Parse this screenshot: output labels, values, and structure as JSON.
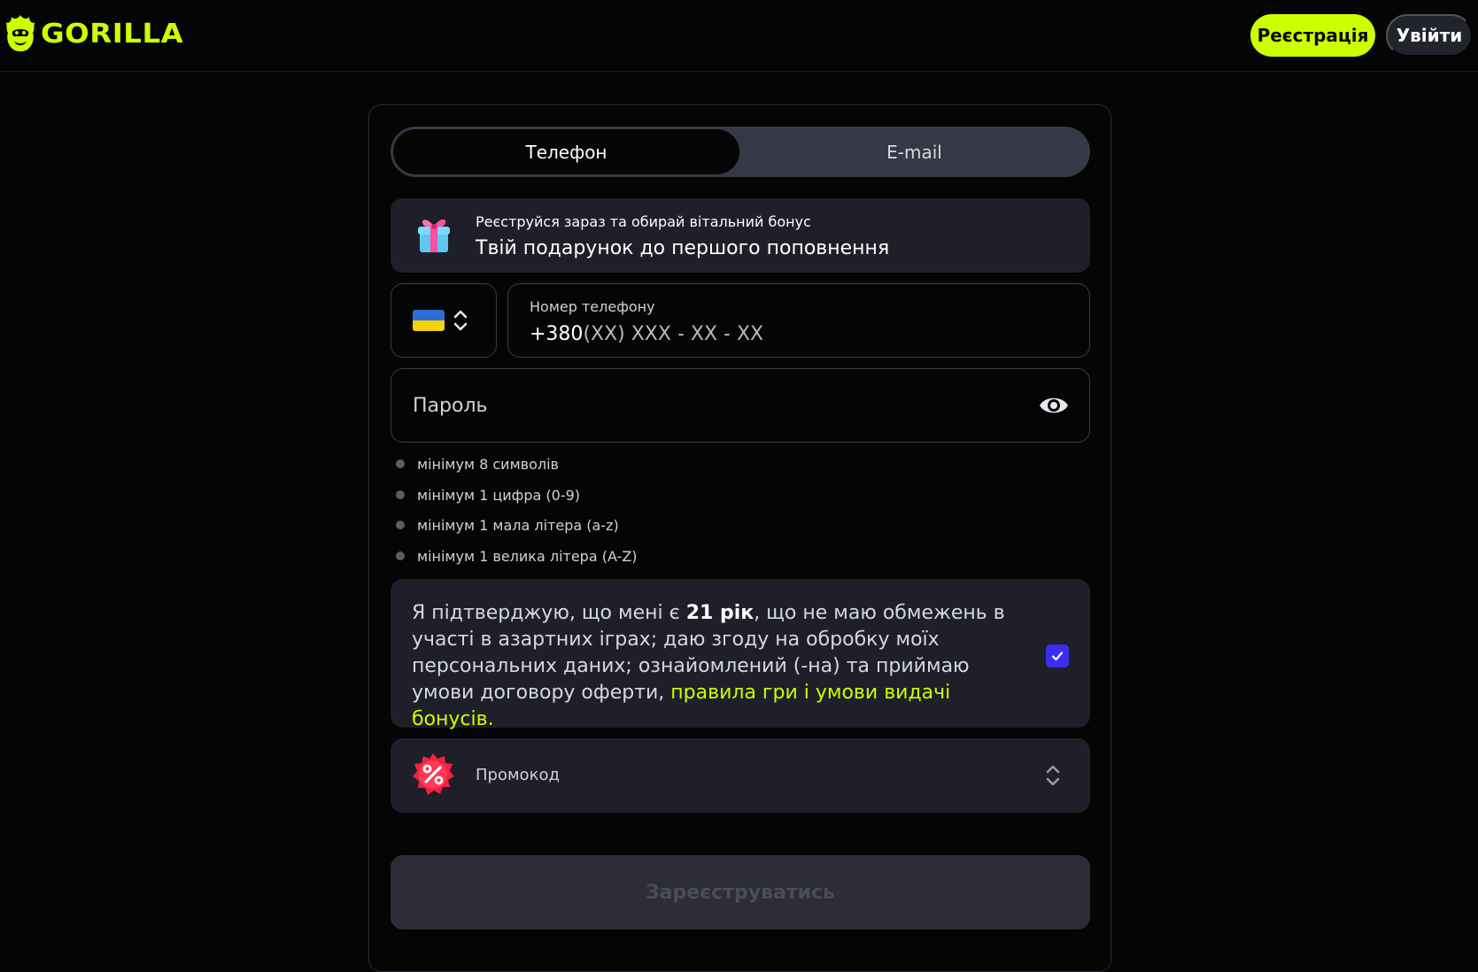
{
  "header": {
    "brand": "GORILLA",
    "register_label": "Реєстрація",
    "login_label": "Увійти"
  },
  "tabs": [
    {
      "label": "Телефон",
      "active": true
    },
    {
      "label": "E-mail",
      "active": false
    }
  ],
  "bonus": {
    "subtitle": "Реєструйся зараз та обирай вітальний бонус",
    "title": "Твій подарунок до першого поповнення"
  },
  "phone": {
    "country": "UA",
    "label": "Номер телефону",
    "prefix": "+380",
    "mask": "(XX) XXX - XX - XX"
  },
  "password": {
    "placeholder": "Пароль"
  },
  "password_rules": [
    "мінімум 8 символів",
    "мінімум 1 цифра (0-9)",
    "мінімум 1 мала літера (a-z)",
    "мінімум 1 велика літера (A-Z)"
  ],
  "consent": {
    "text_before": "Я підтверджую, що мені є ",
    "age": "21 рік",
    "text_after": ", що не маю обмежень в участі в азартних іграх; даю згоду на обробку моїх персональних даних; ознайомлений (-на) та приймаю умови договору оферти, ",
    "link_rules": "правила гри",
    "link_joiner": " і ",
    "link_bonus": "умови видачі бонусів",
    "text_end": ".",
    "checked": true
  },
  "promo": {
    "label": "Промокод"
  },
  "submit_label": "Зареєструватись",
  "colors": {
    "accent": "#ccff00",
    "background": "#050505",
    "panel": "#1e1f28",
    "checkbox": "#3a2ef0"
  },
  "icons": {
    "logo": "gorilla-logo-icon",
    "gift": "gift-icon",
    "flag": "ukraine-flag-icon",
    "country_toggle": "chevron-updown-icon",
    "password_toggle": "eye-icon",
    "checkbox": "check-icon",
    "promo": "percent-badge-icon",
    "promo_toggle": "chevron-updown-icon"
  }
}
